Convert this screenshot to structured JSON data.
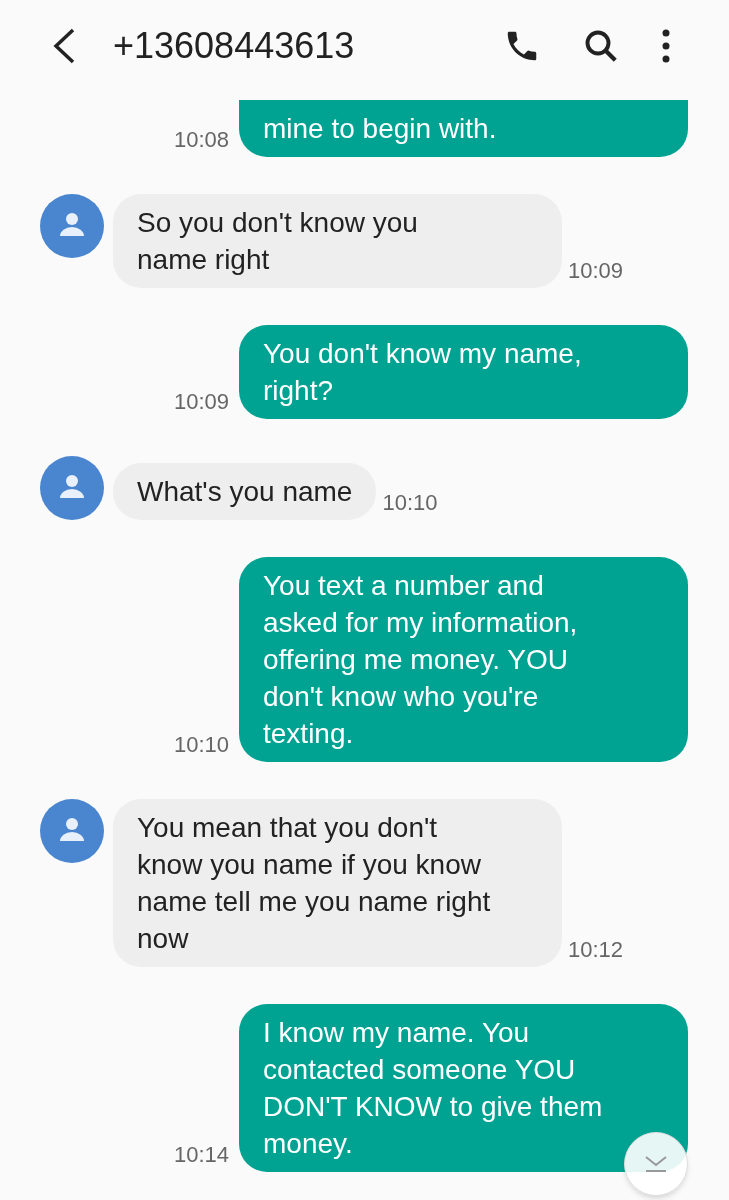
{
  "header": {
    "title": "+13608443613"
  },
  "messages": [
    {
      "kind": "outgoing",
      "text": "mine to begin with.",
      "time": "10:08"
    },
    {
      "kind": "incoming",
      "text": "So you don't know you\nname right",
      "time": "10:09"
    },
    {
      "kind": "outgoing",
      "text": "You don't know my name,\nright?",
      "time": "10:09"
    },
    {
      "kind": "incoming",
      "text": "What's you name",
      "time": "10:10"
    },
    {
      "kind": "outgoing",
      "text": "You text a number and\nasked for my information,\noffering me money. YOU\ndon't know who you're\ntexting.",
      "time": "10:10"
    },
    {
      "kind": "incoming",
      "text": "You mean that you don't\nknow you name if you know\nname tell me you name right\nnow",
      "time": "10:12"
    },
    {
      "kind": "outgoing",
      "text": "I know my name. You\ncontacted someone YOU\nDON'T KNOW to give them\nmoney.",
      "time": "10:14"
    }
  ]
}
